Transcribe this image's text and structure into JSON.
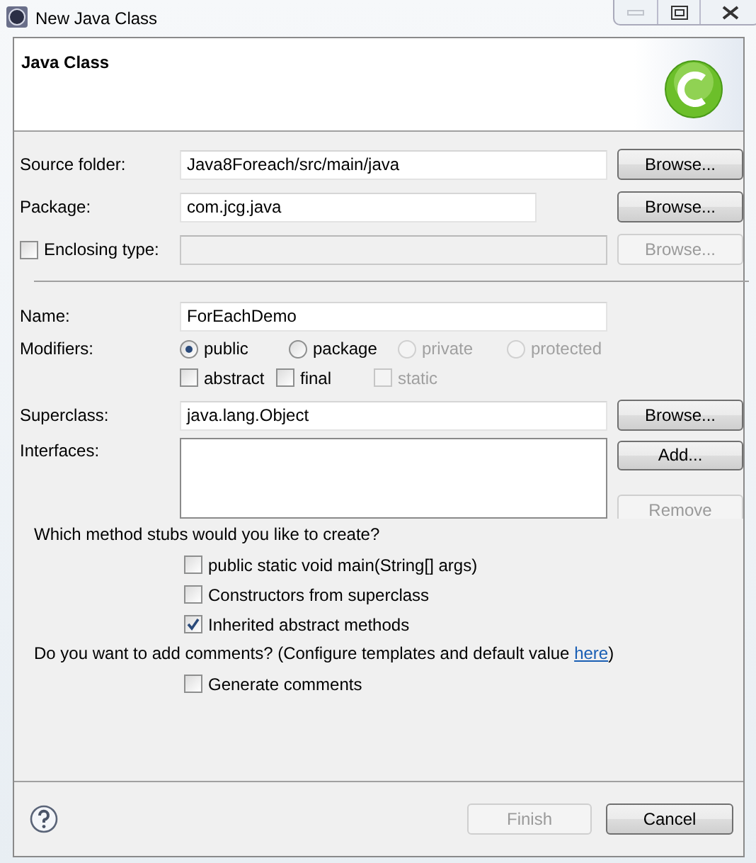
{
  "window": {
    "title": "New Java Class"
  },
  "header": {
    "title": "Java Class"
  },
  "fields": [
    {
      "kind": "text",
      "label": "Source folder:",
      "value": "Java8Foreach/src/main/java",
      "disabled": false,
      "button": {
        "label": "Browse...",
        "disabled": false
      }
    },
    {
      "kind": "text",
      "label": "Package:",
      "value": "com.jcg.java",
      "disabled": false,
      "button": {
        "label": "Browse...",
        "disabled": false
      }
    },
    {
      "kind": "checkbox",
      "label": "Enclosing type:",
      "checked": false,
      "disabled": true,
      "button": {
        "label": "Browse...",
        "disabled": true
      }
    }
  ],
  "name": {
    "label": "Name:",
    "value": "ForEachDemo"
  },
  "modifiers": {
    "label": "Modifiers:",
    "access": [
      {
        "label": "public",
        "selected": true,
        "disabled": false
      },
      {
        "label": "package",
        "selected": false,
        "disabled": false
      },
      {
        "label": "private",
        "selected": false,
        "disabled": true
      },
      {
        "label": "protected",
        "selected": false,
        "disabled": true
      }
    ],
    "flags": [
      {
        "label": "abstract",
        "checked": false,
        "disabled": false
      },
      {
        "label": "final",
        "checked": false,
        "disabled": false
      },
      {
        "label": "static",
        "checked": false,
        "disabled": true
      }
    ]
  },
  "superclass": {
    "label": "Superclass:",
    "value": "java.lang.Object",
    "button": "Browse..."
  },
  "interfaces": {
    "label": "Interfaces:",
    "add": "Add...",
    "remove": "Remove"
  },
  "stubs": {
    "question": "Which method stubs would you like to create?",
    "options": [
      {
        "label": "public static void main(String[] args)",
        "checked": false
      },
      {
        "label": "Constructors from superclass",
        "checked": false
      },
      {
        "label": "Inherited abstract methods",
        "checked": true
      }
    ]
  },
  "comments": {
    "text": "Do you want to add comments? (Configure templates and default value ",
    "link": "here",
    "after": ")",
    "option": {
      "label": "Generate comments",
      "checked": false
    }
  },
  "footer": {
    "finish": {
      "label": "Finish",
      "disabled": true
    },
    "cancel": {
      "label": "Cancel",
      "disabled": false
    }
  }
}
